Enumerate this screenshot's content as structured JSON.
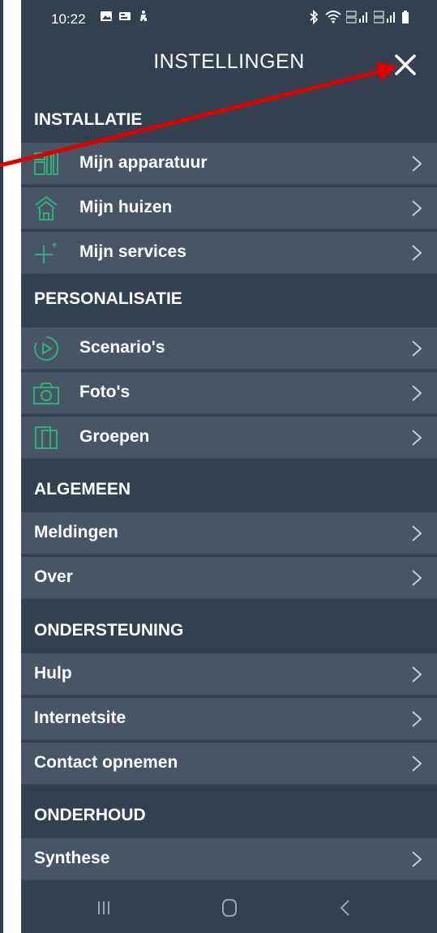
{
  "status_bar": {
    "time": "10:22"
  },
  "header": {
    "title": "INSTELLINGEN"
  },
  "sections": [
    {
      "title": "INSTALLATIE",
      "items": [
        {
          "label": "Mijn apparatuur",
          "icon": "devices-icon"
        },
        {
          "label": "Mijn huizen",
          "icon": "house-icon"
        },
        {
          "label": "Mijn services",
          "icon": "plus-icon"
        }
      ]
    },
    {
      "title": "PERSONALISATIE",
      "items": [
        {
          "label": "Scenario's",
          "icon": "play-circle-icon"
        },
        {
          "label": "Foto's",
          "icon": "camera-icon"
        },
        {
          "label": "Groepen",
          "icon": "groups-icon"
        }
      ]
    },
    {
      "title": "ALGEMEEN",
      "items": [
        {
          "label": "Meldingen"
        },
        {
          "label": "Over"
        }
      ]
    },
    {
      "title": "ONDERSTEUNING",
      "items": [
        {
          "label": "Hulp"
        },
        {
          "label": "Internetsite"
        },
        {
          "label": "Contact opnemen"
        }
      ]
    },
    {
      "title": "ONDERHOUD",
      "items": [
        {
          "label": "Synthese"
        }
      ]
    }
  ],
  "colors": {
    "background": "#334050",
    "row": "#475565",
    "accent_icon": "#2fae7a",
    "annotation_arrow": "#e00000"
  }
}
